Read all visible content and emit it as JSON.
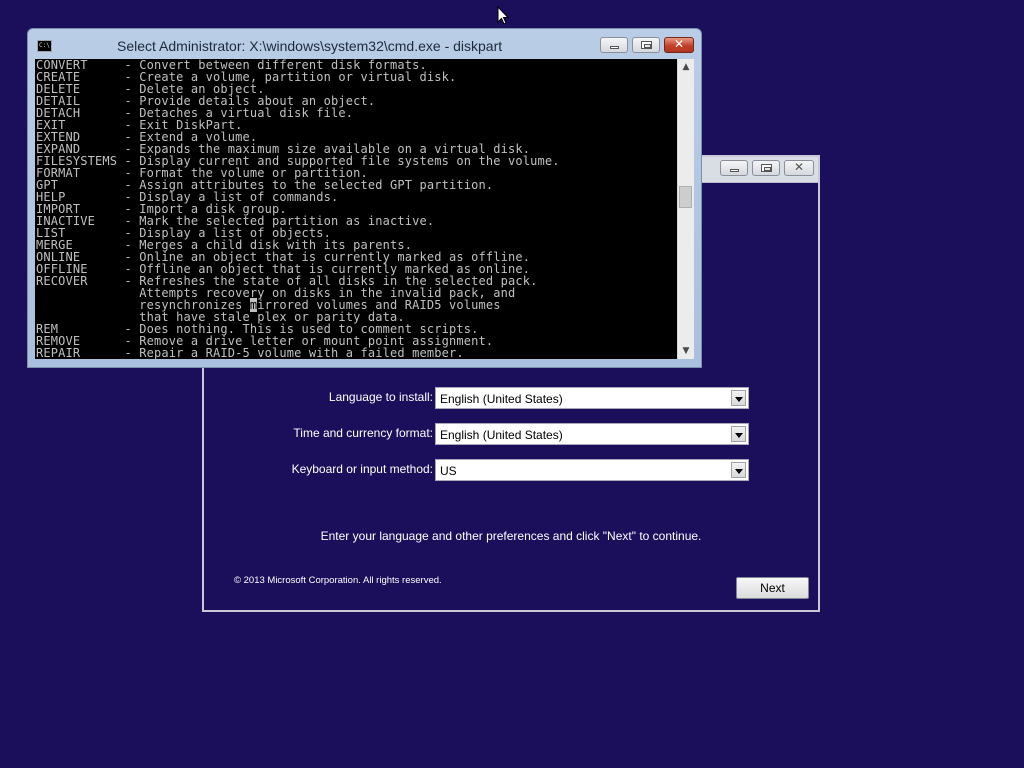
{
  "cmd_window": {
    "title": "Select Administrator: X:\\windows\\system32\\cmd.exe - diskpart",
    "icon": "cmd-icon",
    "icon_text": "C:\\.",
    "console_lines": [
      {
        "cmd": "CONVERT",
        "desc": "Convert between different disk formats."
      },
      {
        "cmd": "CREATE",
        "desc": "Create a volume, partition or virtual disk."
      },
      {
        "cmd": "DELETE",
        "desc": "Delete an object."
      },
      {
        "cmd": "DETAIL",
        "desc": "Provide details about an object."
      },
      {
        "cmd": "DETACH",
        "desc": "Detaches a virtual disk file."
      },
      {
        "cmd": "EXIT",
        "desc": "Exit DiskPart."
      },
      {
        "cmd": "EXTEND",
        "desc": "Extend a volume."
      },
      {
        "cmd": "EXPAND",
        "desc": "Expands the maximum size available on a virtual disk."
      },
      {
        "cmd": "FILESYSTEMS",
        "desc": "Display current and supported file systems on the volume."
      },
      {
        "cmd": "FORMAT",
        "desc": "Format the volume or partition."
      },
      {
        "cmd": "GPT",
        "desc": "Assign attributes to the selected GPT partition."
      },
      {
        "cmd": "HELP",
        "desc": "Display a list of commands."
      },
      {
        "cmd": "IMPORT",
        "desc": "Import a disk group."
      },
      {
        "cmd": "INACTIVE",
        "desc": "Mark the selected partition as inactive."
      },
      {
        "cmd": "LIST",
        "desc": "Display a list of objects."
      },
      {
        "cmd": "MERGE",
        "desc": "Merges a child disk with its parents."
      },
      {
        "cmd": "ONLINE",
        "desc": "Online an object that is currently marked as offline."
      },
      {
        "cmd": "OFFLINE",
        "desc": "Offline an object that is currently marked as online."
      },
      {
        "cmd": "RECOVER",
        "desc": "Refreshes the state of all disks in the selected pack."
      },
      {
        "cmd": "",
        "desc": "Attempts recovery on disks in the invalid pack, and"
      },
      {
        "cmd": "",
        "desc": "resynchronizes mirrored volumes and RAID5 volumes"
      },
      {
        "cmd": "",
        "desc": "that have stale plex or parity data."
      },
      {
        "cmd": "REM",
        "desc": "Does nothing. This is used to comment scripts."
      },
      {
        "cmd": "REMOVE",
        "desc": "Remove a drive letter or mount point assignment."
      },
      {
        "cmd": "REPAIR",
        "desc": "Repair a RAID-5 volume with a failed member."
      }
    ],
    "scroll_position": 0.45
  },
  "setup_window": {
    "fields": [
      {
        "label": "Language to install:",
        "value": "English (United States)"
      },
      {
        "label": "Time and currency format:",
        "value": "English (United States)"
      },
      {
        "label": "Keyboard or input method:",
        "value": "US"
      }
    ],
    "instruction": "Enter your language and other preferences and click \"Next\" to continue.",
    "copyright": "© 2013 Microsoft Corporation. All rights reserved.",
    "next_label": "Next"
  },
  "colors": {
    "desktop_background": "#1b0f5c",
    "console_text": "#c0c0c0",
    "close_button": "#c2402a"
  }
}
